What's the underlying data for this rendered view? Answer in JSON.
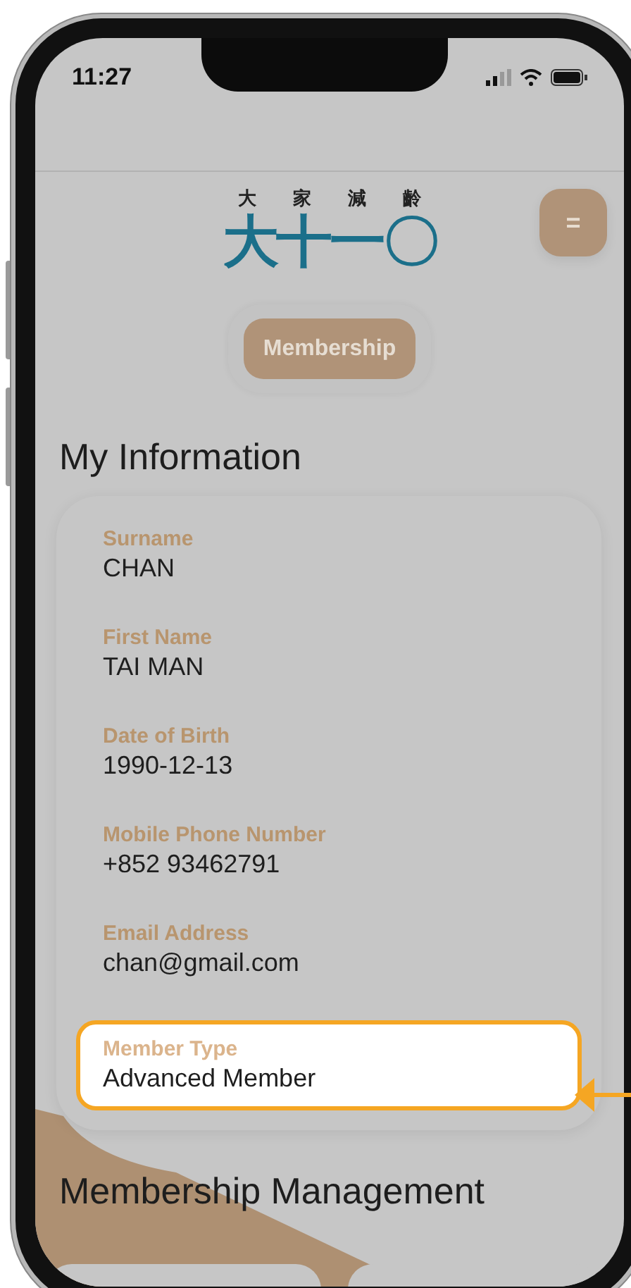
{
  "status_bar": {
    "time": "11:27"
  },
  "header": {
    "logo_top": "大家減齡",
    "logo_main": "大十一〇",
    "menu_button": "="
  },
  "nav": [
    {
      "label": "Membership",
      "selected": true
    }
  ],
  "my_information": {
    "title": "My Information",
    "fields": [
      {
        "label": "Surname",
        "value": "CHAN",
        "highlighted": false
      },
      {
        "label": "First Name",
        "value": "TAI MAN",
        "highlighted": false
      },
      {
        "label": "Date of Birth",
        "value": "1990-12-13",
        "highlighted": false
      },
      {
        "label": "Mobile Phone Number",
        "value": "+852 93462791",
        "highlighted": false
      },
      {
        "label": "Email Address",
        "value": "chan@gmail.com",
        "highlighted": false
      },
      {
        "label": "Member Type",
        "value": "Advanced Member",
        "highlighted": true
      }
    ]
  },
  "membership_management": {
    "title": "Membership Management"
  }
}
